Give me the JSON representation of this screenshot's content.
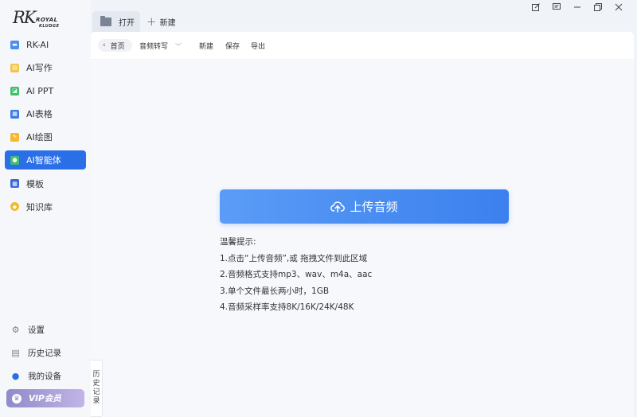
{
  "logo": {
    "rk": "RK",
    "line1": "ROYAL",
    "line2": "KLUDGE"
  },
  "sidebar": {
    "items": [
      {
        "label": "RK-AI",
        "icon": "rk-ai-icon",
        "color": "#4a8ff0",
        "active": false
      },
      {
        "label": "AI写作",
        "icon": "ai-write-icon",
        "color": "#f5c54a",
        "active": false
      },
      {
        "label": "AI PPT",
        "icon": "ai-ppt-icon",
        "color": "#3fc16b",
        "active": false
      },
      {
        "label": "AI表格",
        "icon": "ai-table-icon",
        "color": "#3a7be8",
        "active": false
      },
      {
        "label": "AI绘图",
        "icon": "ai-draw-icon",
        "color": "#f5b82e",
        "active": false
      },
      {
        "label": "AI智能体",
        "icon": "ai-agent-icon",
        "color": "#3fc16b",
        "active": true
      },
      {
        "label": "模板",
        "icon": "template-icon",
        "color": "#3a66d8",
        "active": false
      },
      {
        "label": "知识库",
        "icon": "knowledge-icon",
        "color": "#f5b82e",
        "active": false
      }
    ],
    "bottom": [
      {
        "label": "设置",
        "icon": "gear-icon"
      },
      {
        "label": "历史记录",
        "icon": "history-icon"
      },
      {
        "label": "我的设备",
        "icon": "device-icon"
      }
    ],
    "vip_label": "VIP会员",
    "history_tab": [
      "历",
      "史",
      "记",
      "录"
    ]
  },
  "tabs": {
    "open_label": "打开",
    "new_label": "新建"
  },
  "toolbar": {
    "home_label": "首页",
    "audio_label": "音频转写",
    "new_label": "新建",
    "save_label": "保存",
    "export_label": "导出"
  },
  "upload": {
    "button_label": "上传音频",
    "tips_title": "温馨提示:",
    "tips": [
      "1.点击“上传音频”,或 拖拽文件到此区域",
      "2.音频格式支持mp3、wav、m4a、aac",
      "3.单个文件最长两小时，1GB",
      "4.音频采样率支持8K/16K/24K/48K"
    ]
  },
  "colors": {
    "accent": "#2b6fe8",
    "upload_start": "#5a9cf6",
    "upload_end": "#3b80ee"
  }
}
